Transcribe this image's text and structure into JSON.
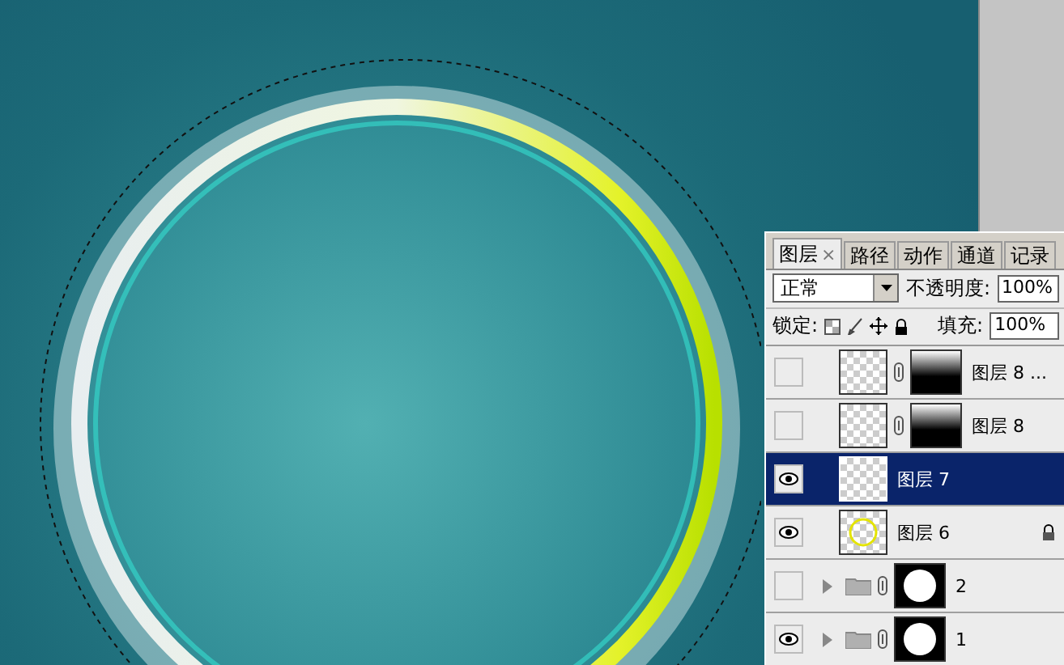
{
  "panel": {
    "tabs": [
      {
        "label": "图层",
        "selected": true,
        "close": "×"
      },
      {
        "label": "路径",
        "selected": false
      },
      {
        "label": "动作",
        "selected": false
      },
      {
        "label": "通道",
        "selected": false
      },
      {
        "label": "记录",
        "selected": false
      }
    ],
    "blend_mode": "正常",
    "opacity_label": "不透明度:",
    "opacity": "100%",
    "lock_label": "锁定:",
    "fill_label": "填充:",
    "fill": "100%",
    "layers": [
      {
        "kind": "layer",
        "name": "图层 8 ...",
        "visible": false,
        "selected": false,
        "mask": true,
        "locked": false
      },
      {
        "kind": "layer",
        "name": "图层 8",
        "visible": false,
        "selected": false,
        "mask": true,
        "locked": false
      },
      {
        "kind": "layer",
        "name": "图层 7",
        "visible": true,
        "selected": true,
        "mask": false,
        "locked": false
      },
      {
        "kind": "layer",
        "name": "图层 6",
        "visible": true,
        "selected": false,
        "mask": false,
        "locked": true
      },
      {
        "kind": "group",
        "name": "2",
        "visible": false,
        "selected": false,
        "mask": true,
        "locked": false
      },
      {
        "kind": "group",
        "name": "1",
        "visible": true,
        "selected": false,
        "mask": true,
        "locked": false
      }
    ]
  }
}
